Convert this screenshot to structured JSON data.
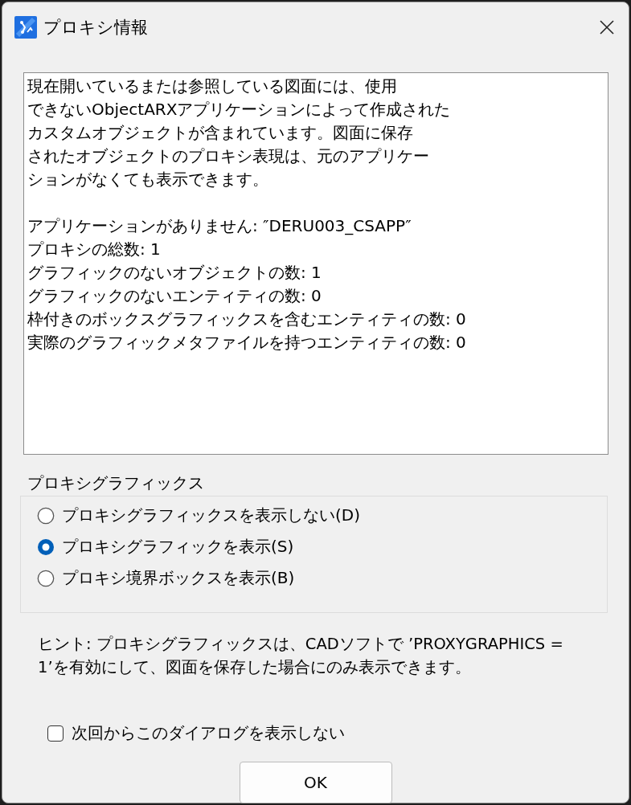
{
  "window": {
    "title": "プロキシ情報"
  },
  "message_lines": [
    "現在開いているまたは参照している図面には、使用",
    "できないObjectARXアプリケーションによって作成された",
    "カスタムオブジェクトが含まれています。図面に保存",
    "されたオブジェクトのプロキシ表現は、元のアプリケー",
    "ションがなくても表示できます。"
  ],
  "details": [
    "アプリケーションがありません: ″DERU003_CSAPP″",
    "プロキシの総数: 1",
    "グラフィックのないオブジェクトの数: 1",
    "グラフィックのないエンティティの数: 0",
    "枠付きのボックスグラフィックスを含むエンティティの数: 0",
    "実際のグラフィックメタファイルを持つエンティティの数: 0"
  ],
  "group": {
    "title": "プロキシグラフィックス",
    "options": [
      {
        "label": "プロキシグラフィックスを表示しない(D)",
        "selected": false
      },
      {
        "label": "プロキシグラフィックを表示(S)",
        "selected": true
      },
      {
        "label": "プロキシ境界ボックスを表示(B)",
        "selected": false
      }
    ]
  },
  "hint_lines": [
    "ヒント: プロキシグラフィックスは、CADソフトで ’PROXYGRAPHICS =",
    "1’を有効にして、図面を保存した場合にのみ表示できます。"
  ],
  "dont_show": {
    "label": "次回からこのダイアログを表示しない",
    "checked": false
  },
  "ok_button": "OK"
}
